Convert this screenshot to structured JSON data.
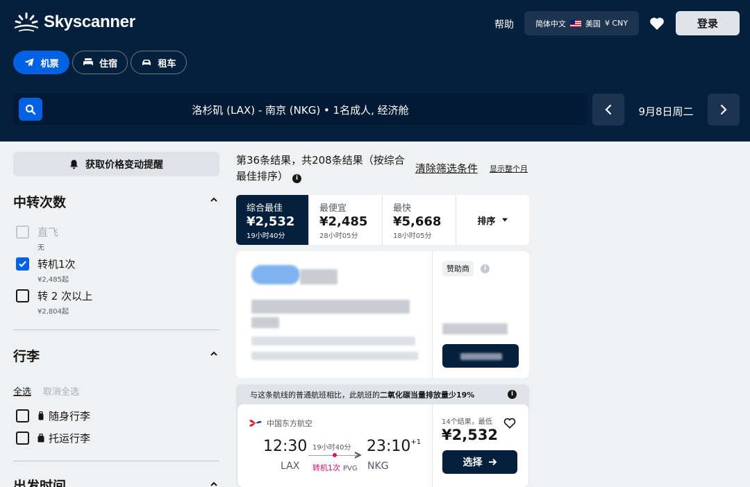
{
  "brand": {
    "name": "Skyscanner"
  },
  "header": {
    "help": "帮助",
    "language": "简体中文",
    "country": "美国",
    "currency": "¥ CNY",
    "login": "登录"
  },
  "tabs": [
    {
      "label": "机票",
      "icon": "plane-icon",
      "active": true
    },
    {
      "label": "住宿",
      "icon": "bed-icon",
      "active": false
    },
    {
      "label": "租车",
      "icon": "car-icon",
      "active": false
    }
  ],
  "search": {
    "summary": "洛杉矶 (LAX) - 南京 (NKG)  •  1名成人, 经济舱",
    "date": "9月8日周二"
  },
  "sidebar": {
    "price_alert": "获取价格变动提醒",
    "stops": {
      "title": "中转次数",
      "options": [
        {
          "label": "直飞",
          "sub": "无",
          "checked": false,
          "disabled": true
        },
        {
          "label": "转机1次",
          "sub": "¥2,485起",
          "checked": true,
          "disabled": false
        },
        {
          "label": "转 2 次以上",
          "sub": "¥2,804起",
          "checked": false,
          "disabled": false
        }
      ]
    },
    "baggage": {
      "title": "行李",
      "select_all": "全选",
      "deselect_all": "取消全选",
      "options": [
        {
          "label": "随身行李",
          "checked": false
        },
        {
          "label": "托运行李",
          "checked": false
        }
      ]
    },
    "departure": {
      "title": "出发时间"
    }
  },
  "results": {
    "count_text": "第36条结果，共208条结果（按综合最佳排序）",
    "clear_filters": "清除筛选条件",
    "show_month": "显示整个月",
    "sort_tabs": [
      {
        "label": "综合最佳",
        "price": "¥2,532",
        "duration": "19小时40分",
        "active": true
      },
      {
        "label": "最便宜",
        "price": "¥2,485",
        "duration": "28小时05分",
        "active": false
      },
      {
        "label": "最快",
        "price": "¥5,668",
        "duration": "18小时05分",
        "active": false
      }
    ],
    "sort_label": "排序",
    "sponsored_label": "赞助商",
    "eco_text_prefix": "与这条航线的普通航班相比，此航班的",
    "eco_text_bold": "二氧化碳当量排放量少19%",
    "flight": {
      "airline": "中国东方航空",
      "depart_time": "12:30",
      "depart_code": "LAX",
      "arrive_time": "23:10",
      "arrive_offset": "+1",
      "arrive_code": "NKG",
      "duration": "19小时40分",
      "stops": "转机1次",
      "stop_airport": "PVG",
      "meta": "14个结果，最低",
      "price": "¥2,532",
      "select": "选择"
    }
  },
  "colors": {
    "navy": "#05203c",
    "blue": "#0062e3",
    "pink": "#e70866"
  }
}
